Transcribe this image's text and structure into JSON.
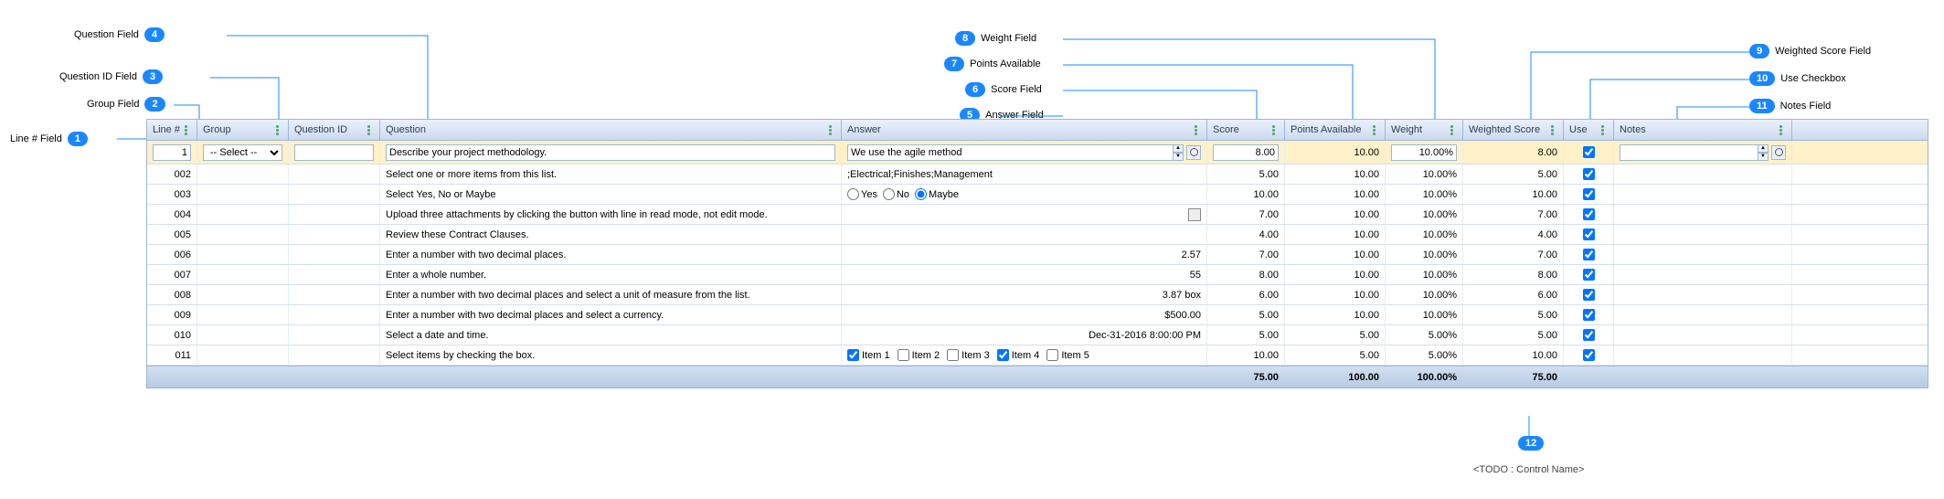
{
  "callouts": {
    "1": "Line # Field",
    "2": "Group Field",
    "3": "Question ID Field",
    "4": "Question Field",
    "5": "Answer Field",
    "6": "Score Field",
    "7": "Points Available",
    "8": "Weight Field",
    "9": "Weighted Score Field",
    "10": "Use Checkbox",
    "11": "Notes Field"
  },
  "headers": {
    "line": "Line #",
    "group": "Group",
    "qid": "Question ID",
    "question": "Question",
    "answer": "Answer",
    "score": "Score",
    "points": "Points Available",
    "weight": "Weight",
    "wscore": "Weighted Score",
    "use": "Use",
    "notes": "Notes"
  },
  "editRow": {
    "line": "1",
    "groupPlaceholder": "-- Select --",
    "question": "Describe your project methodology.",
    "answer": "We use the agile method",
    "score": "8.00",
    "points": "10.00",
    "weight": "10.00%",
    "wscore": "8.00"
  },
  "rows": [
    {
      "line": "002",
      "question": "Select one or more items from this list.",
      "answerText": ";Electrical;Finishes;Management",
      "score": "5.00",
      "points": "10.00",
      "weight": "10.00%",
      "wscore": "5.00",
      "use": true
    },
    {
      "line": "003",
      "question": "Select Yes, No or Maybe",
      "answerRadio": {
        "options": [
          "Yes",
          "No",
          "Maybe"
        ],
        "selected": "Maybe"
      },
      "score": "10.00",
      "points": "10.00",
      "weight": "10.00%",
      "wscore": "10.00",
      "use": true
    },
    {
      "line": "004",
      "question": "Upload three attachments by clicking the button with line in read mode, not edit mode.",
      "answerSquare": true,
      "score": "7.00",
      "points": "10.00",
      "weight": "10.00%",
      "wscore": "7.00",
      "use": true
    },
    {
      "line": "005",
      "question": "Review these Contract Clauses.",
      "score": "4.00",
      "points": "10.00",
      "weight": "10.00%",
      "wscore": "4.00",
      "use": true
    },
    {
      "line": "006",
      "question": "Enter a number with two decimal places.",
      "answerText": "2.57",
      "answerRight": true,
      "score": "7.00",
      "points": "10.00",
      "weight": "10.00%",
      "wscore": "7.00",
      "use": true
    },
    {
      "line": "007",
      "question": "Enter a whole number.",
      "answerText": "55",
      "answerRight": true,
      "score": "8.00",
      "points": "10.00",
      "weight": "10.00%",
      "wscore": "8.00",
      "use": true
    },
    {
      "line": "008",
      "question": "Enter a number with two decimal places and select a unit of measure from the list.",
      "answerText": "3.87 box",
      "answerRight": true,
      "score": "6.00",
      "points": "10.00",
      "weight": "10.00%",
      "wscore": "6.00",
      "use": true
    },
    {
      "line": "009",
      "question": "Enter a number with two decimal places and select a currency.",
      "answerText": "$500.00",
      "answerRight": true,
      "score": "5.00",
      "points": "10.00",
      "weight": "10.00%",
      "wscore": "5.00",
      "use": true
    },
    {
      "line": "010",
      "question": "Select a date and time.",
      "answerText": "Dec-31-2016 8:00:00 PM",
      "answerRight": true,
      "score": "5.00",
      "points": "5.00",
      "weight": "5.00%",
      "wscore": "5.00",
      "use": true
    },
    {
      "line": "011",
      "question": "Select items by checking the box.",
      "answerChecks": [
        {
          "label": "Item 1",
          "checked": true
        },
        {
          "label": "Item 2",
          "checked": false
        },
        {
          "label": "Item 3",
          "checked": false
        },
        {
          "label": "Item 4",
          "checked": true
        },
        {
          "label": "Item 5",
          "checked": false
        }
      ],
      "score": "10.00",
      "points": "5.00",
      "weight": "5.00%",
      "wscore": "10.00",
      "use": true
    }
  ],
  "totals": {
    "score": "75.00",
    "points": "100.00",
    "weight": "100.00%",
    "wscore": "75.00"
  },
  "todoBadge": "12",
  "todoText": "<TODO : Control Name>"
}
